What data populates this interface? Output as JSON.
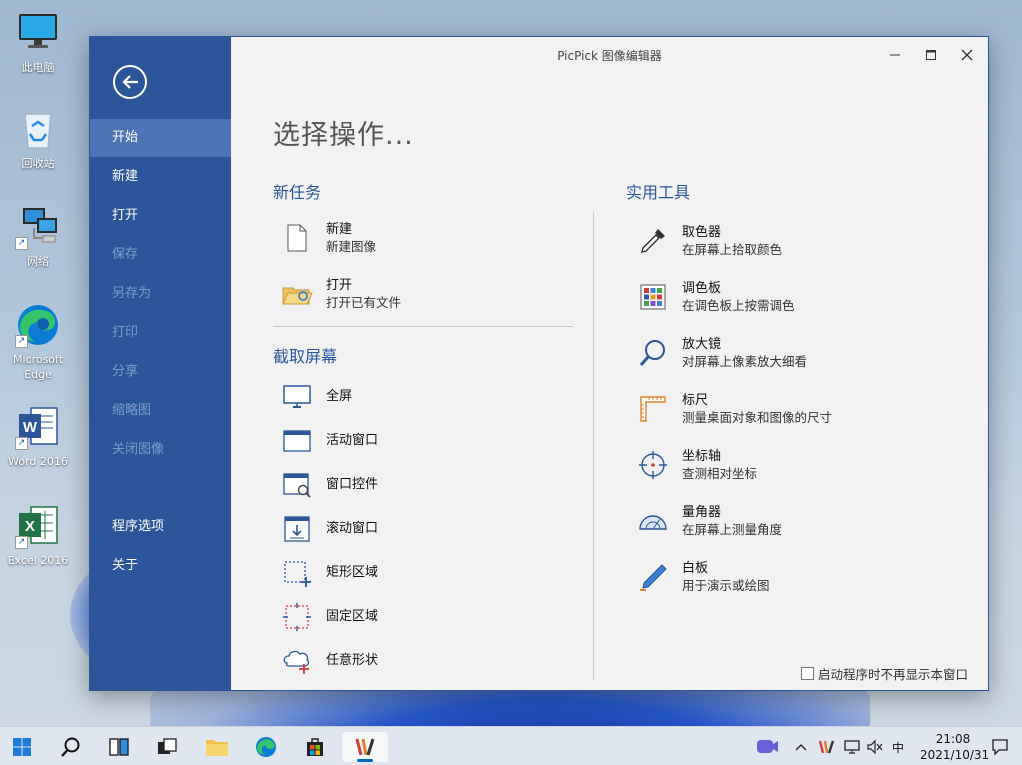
{
  "desktop": {
    "icons": [
      {
        "label": "此电脑"
      },
      {
        "label": "回收站"
      },
      {
        "label": "网络"
      },
      {
        "label": "Microsoft Edge"
      },
      {
        "label": "Word 2016"
      },
      {
        "label": "Excel 2016"
      }
    ]
  },
  "window": {
    "title": "PicPick 图像编辑器",
    "heading": "选择操作...",
    "sidebar": {
      "items": [
        {
          "label": "开始",
          "state": "active"
        },
        {
          "label": "新建",
          "state": "enabled"
        },
        {
          "label": "打开",
          "state": "enabled"
        },
        {
          "label": "保存",
          "state": "disabled"
        },
        {
          "label": "另存为",
          "state": "disabled"
        },
        {
          "label": "打印",
          "state": "disabled"
        },
        {
          "label": "分享",
          "state": "disabled"
        },
        {
          "label": "缩略图",
          "state": "disabled"
        },
        {
          "label": "关闭图像",
          "state": "disabled"
        },
        {
          "label": "程序选项",
          "state": "enabled"
        },
        {
          "label": "关于",
          "state": "enabled"
        }
      ]
    },
    "new_task": {
      "title": "新任务",
      "items": [
        {
          "label": "新建",
          "desc": "新建图像",
          "icon": "blank-document-icon"
        },
        {
          "label": "打开",
          "desc": "打开已有文件",
          "icon": "open-folder-icon"
        }
      ]
    },
    "capture": {
      "title": "截取屏幕",
      "items": [
        {
          "label": "全屏",
          "icon": "monitor-icon"
        },
        {
          "label": "活动窗口",
          "icon": "active-window-icon"
        },
        {
          "label": "窗口控件",
          "icon": "window-control-icon"
        },
        {
          "label": "滚动窗口",
          "icon": "scrolling-window-icon"
        },
        {
          "label": "矩形区域",
          "icon": "rectangle-region-icon"
        },
        {
          "label": "固定区域",
          "icon": "fixed-region-icon"
        },
        {
          "label": "任意形状",
          "icon": "freehand-shape-icon"
        }
      ]
    },
    "tools": {
      "title": "实用工具",
      "items": [
        {
          "label": "取色器",
          "desc": "在屏幕上拾取颜色",
          "icon": "eyedropper-icon"
        },
        {
          "label": "调色板",
          "desc": "在调色板上按需调色",
          "icon": "palette-grid-icon"
        },
        {
          "label": "放大镜",
          "desc": "对屏幕上像素放大细看",
          "icon": "magnifier-icon"
        },
        {
          "label": "标尺",
          "desc": "测量桌面对象和图像的尺寸",
          "icon": "ruler-icon"
        },
        {
          "label": "坐标轴",
          "desc": "查测相对坐标",
          "icon": "crosshair-icon"
        },
        {
          "label": "量角器",
          "desc": "在屏幕上测量角度",
          "icon": "protractor-icon"
        },
        {
          "label": "白板",
          "desc": "用于演示或绘图",
          "icon": "pen-icon"
        }
      ]
    },
    "startup_checkbox": {
      "label": "启动程序时不再显示本窗口",
      "checked": false
    }
  },
  "taskbar": {
    "tray": {
      "ime": "中",
      "time": "21:08",
      "date": "2021/10/31"
    }
  },
  "colors": {
    "sidebar_bg": "#2b579a",
    "sidebar_active": "#4c73b3",
    "section_title": "#2b579a",
    "window_bg": "#f2f2f2"
  }
}
